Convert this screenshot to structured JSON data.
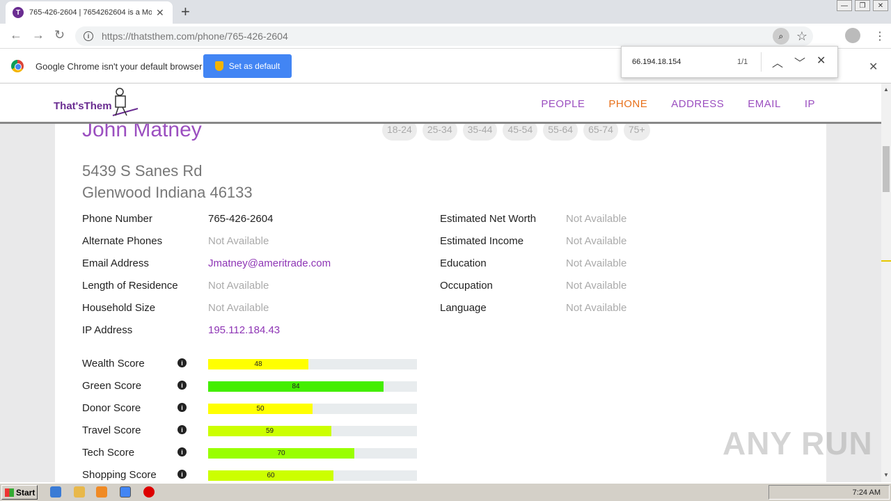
{
  "browser": {
    "tab_title": "765-426-2604 | 7654262604 is a Mo",
    "tab_favicon_letter": "T",
    "url_domain": "https://thatsthem.com",
    "url_path": "/phone/765-426-2604",
    "infobar_text": "Google Chrome isn't your default browser",
    "infobar_button": "Set as default",
    "find_query": "66.194.18.154",
    "find_count": "1/1"
  },
  "site": {
    "logo": "That'sThem",
    "nav": [
      "PEOPLE",
      "PHONE",
      "ADDRESS",
      "EMAIL",
      "IP"
    ],
    "active_nav": "PHONE"
  },
  "person": {
    "name": "John Matney",
    "age_ranges": [
      "18-24",
      "25-34",
      "35-44",
      "45-54",
      "55-64",
      "65-74",
      "75+"
    ],
    "address_line1": "5439 S Sanes Rd",
    "address_line2": "Glenwood Indiana 46133"
  },
  "details_left": [
    {
      "label": "Phone Number",
      "value": "765-426-2604",
      "style": "normal"
    },
    {
      "label": "Alternate Phones",
      "value": "Not Available",
      "style": "na"
    },
    {
      "label": "Email Address",
      "value": "Jmatney@ameritrade.com",
      "style": "link"
    },
    {
      "label": "Length of Residence",
      "value": "Not Available",
      "style": "na"
    },
    {
      "label": "Household Size",
      "value": "Not Available",
      "style": "na"
    },
    {
      "label": "IP Address",
      "value": "195.112.184.43",
      "style": "link"
    }
  ],
  "details_right": [
    {
      "label": "Estimated Net Worth",
      "value": "Not Available"
    },
    {
      "label": "Estimated Income",
      "value": "Not Available"
    },
    {
      "label": "Education",
      "value": "Not Available"
    },
    {
      "label": "Occupation",
      "value": "Not Available"
    },
    {
      "label": "Language",
      "value": "Not Available"
    }
  ],
  "scores": [
    {
      "label": "Wealth Score",
      "value": 48,
      "color": "#ffff00"
    },
    {
      "label": "Green Score",
      "value": 84,
      "color": "#44ee00"
    },
    {
      "label": "Donor Score",
      "value": 50,
      "color": "#ffff00"
    },
    {
      "label": "Travel Score",
      "value": 59,
      "color": "#ccff00"
    },
    {
      "label": "Tech Score",
      "value": 70,
      "color": "#99ff00"
    },
    {
      "label": "Shopping Score",
      "value": 60,
      "color": "#ccff00"
    }
  ],
  "watermark": "ANY RUN",
  "taskbar": {
    "start": "Start",
    "clock": "7:24 AM"
  }
}
